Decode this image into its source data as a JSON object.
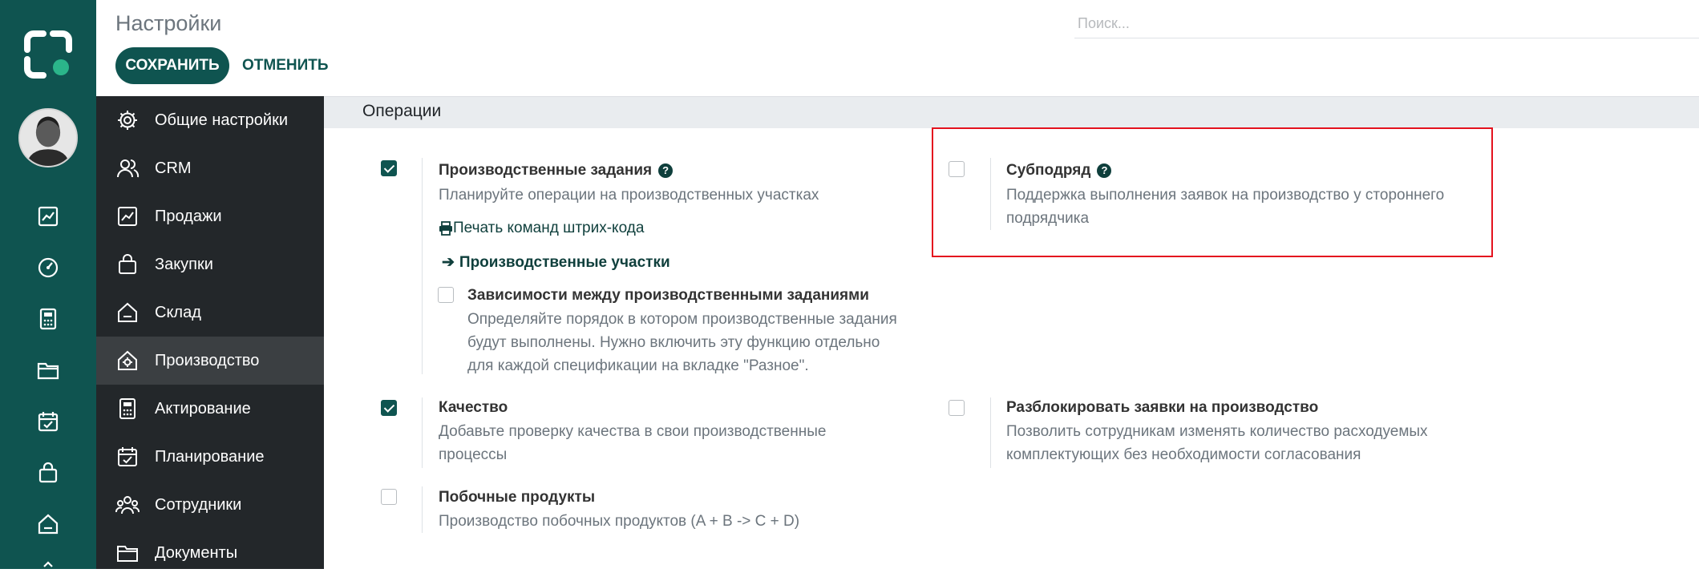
{
  "header": {
    "title": "Настройки",
    "save_label": "СОХРАНИТЬ",
    "cancel_label": "ОТМЕНИТЬ",
    "search_placeholder": "Поиск..."
  },
  "app_rail": {
    "icons": [
      "logo-icon",
      "avatar",
      "chart-icon",
      "gauge-icon",
      "calculator-icon",
      "folder-icon",
      "calendar-check-icon",
      "bag-icon",
      "home-icon"
    ]
  },
  "sidebar": {
    "items": [
      {
        "label": "Общие настройки",
        "icon": "gear-icon"
      },
      {
        "label": "CRM",
        "icon": "users-icon"
      },
      {
        "label": "Продажи",
        "icon": "chart-icon"
      },
      {
        "label": "Закупки",
        "icon": "bag-icon"
      },
      {
        "label": "Склад",
        "icon": "home-icon"
      },
      {
        "label": "Производство",
        "icon": "factory-icon",
        "active": true
      },
      {
        "label": "Актирование",
        "icon": "calculator-icon"
      },
      {
        "label": "Планирование",
        "icon": "calendar-check-icon"
      },
      {
        "label": "Сотрудники",
        "icon": "team-icon"
      },
      {
        "label": "Документы",
        "icon": "folder-icon"
      }
    ]
  },
  "section": {
    "title": "Операции"
  },
  "settings": {
    "work_orders": {
      "title": "Производственные задания",
      "desc": "Планируйте операции на производственных участках",
      "checked": true,
      "link_print": "Печать команд штрих-кода",
      "link_workcenters": "Производственные участки",
      "dependencies": {
        "title": "Зависимости между производственными заданиями",
        "desc_lines": [
          "Определяйте порядок в котором производственные задания",
          "будут выполнены. Нужно включить эту функцию отдельно",
          "для каждой спецификации на вкладке \"Разное\"."
        ],
        "checked": false
      }
    },
    "subcontracting": {
      "title": "Субподряд",
      "desc_lines": [
        "Поддержка выполнения заявок на производство у стороннего",
        "подрядчика"
      ],
      "checked": false
    },
    "quality": {
      "title": "Качество",
      "desc_lines": [
        "Добавьте проверку качества в свои производственные",
        "процессы"
      ],
      "checked": true
    },
    "unlock_orders": {
      "title": "Разблокировать заявки на производство",
      "desc_lines": [
        "Позволить сотрудникам изменять количество расходуемых",
        "комплектующих без необходимости согласования"
      ],
      "checked": false
    },
    "byproducts": {
      "title": "Побочные продукты",
      "desc": "Производство побочных продуктов (A + B -> C + D)",
      "checked": false
    }
  },
  "colors": {
    "brand": "#0f5450",
    "sidebar_bg": "#23272a",
    "highlight_border": "#e4121e"
  }
}
